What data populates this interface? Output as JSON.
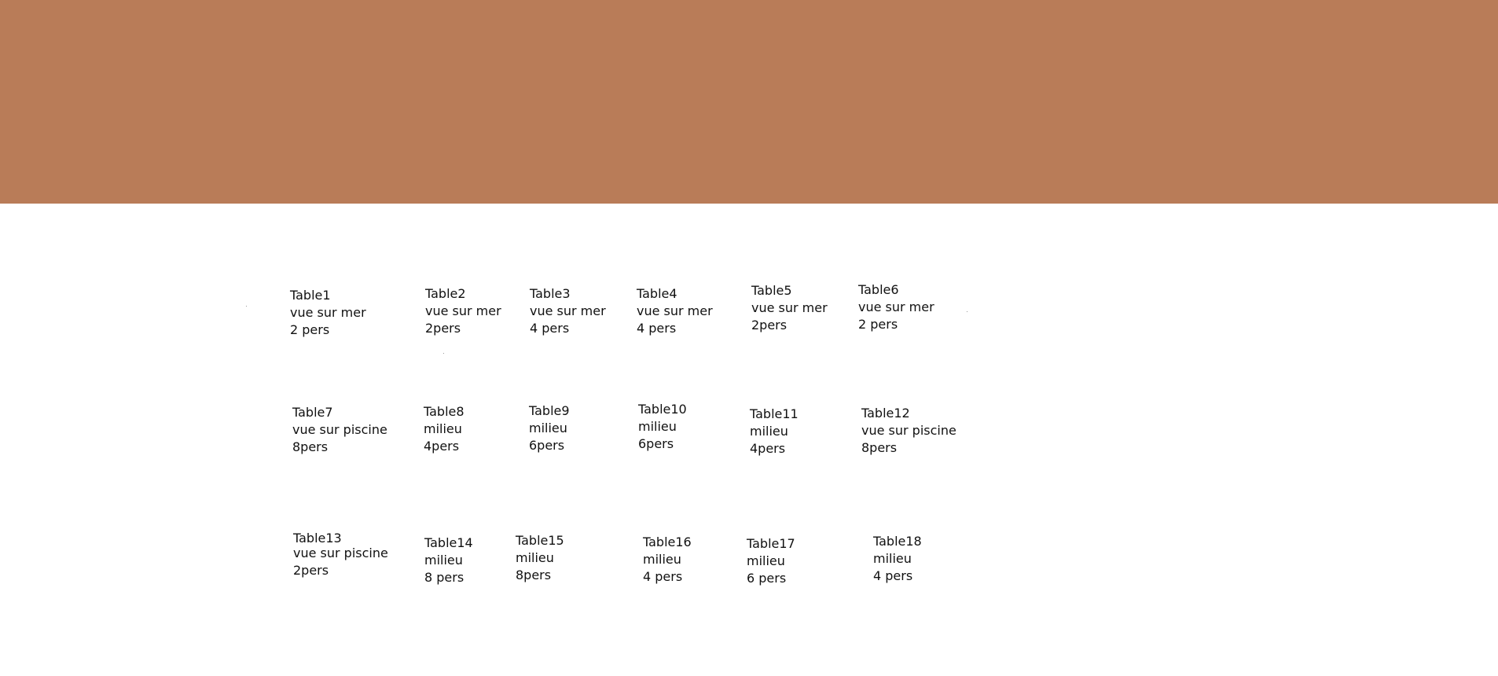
{
  "colors": {
    "banner": "#b97c58",
    "background": "#ffffff",
    "text": "#111111"
  },
  "tables": [
    {
      "name": "Table1",
      "location": "vue sur mer",
      "capacity": "2 pers"
    },
    {
      "name": "Table2",
      "location": "vue sur mer",
      "capacity": "2pers"
    },
    {
      "name": "Table3",
      "location": "vue sur mer",
      "capacity": "4 pers"
    },
    {
      "name": "Table4",
      "location": "vue sur mer",
      "capacity": "4 pers"
    },
    {
      "name": "Table5",
      "location": "vue sur mer",
      "capacity": "2pers"
    },
    {
      "name": "Table6",
      "location": "vue sur mer",
      "capacity": "2 pers"
    },
    {
      "name": "Table7",
      "location": "vue sur piscine",
      "capacity": "8pers"
    },
    {
      "name": "Table8",
      "location": "milieu",
      "capacity": "4pers"
    },
    {
      "name": "Table9",
      "location": "milieu",
      "capacity": "6pers"
    },
    {
      "name": "Table10",
      "location": "milieu",
      "capacity": "6pers"
    },
    {
      "name": "Table11",
      "location": "milieu",
      "capacity": "4pers"
    },
    {
      "name": "Table12",
      "location": "vue sur piscine",
      "capacity": "8pers"
    },
    {
      "name": "Table13",
      "location": "vue sur piscine",
      "capacity": "2pers"
    },
    {
      "name": "Table14",
      "location": "milieu",
      "capacity": "8 pers"
    },
    {
      "name": "Table15",
      "location": "milieu",
      "capacity": "8pers"
    },
    {
      "name": "Table16",
      "location": "milieu",
      "capacity": "4 pers"
    },
    {
      "name": "Table17",
      "location": "milieu",
      "capacity": "6 pers"
    },
    {
      "name": "Table18",
      "location": "milieu",
      "capacity": "4 pers"
    }
  ]
}
